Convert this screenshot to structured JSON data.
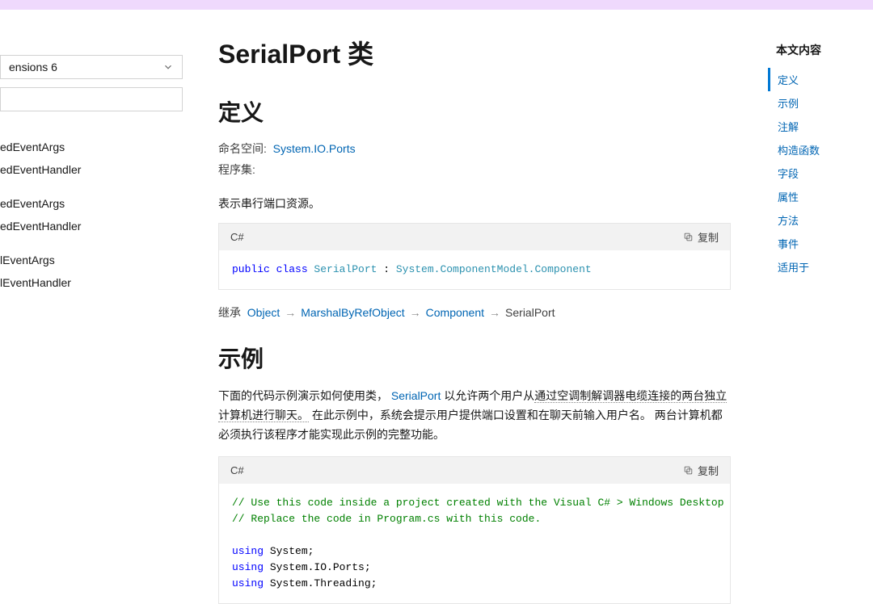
{
  "banner_text": "",
  "sidebar": {
    "version_label": "ensions 6",
    "groups": [
      {
        "items": [
          "edEventArgs",
          "edEventHandler"
        ]
      },
      {
        "items": [
          "edEventArgs",
          "edEventHandler"
        ]
      },
      {
        "items": [
          "lEventArgs",
          "lEventHandler"
        ]
      }
    ]
  },
  "page": {
    "title": "SerialPort 类",
    "h2_definition": "定义",
    "namespace_label": "命名空间:",
    "namespace_link": "System.IO.Ports",
    "assembly_label": "程序集:",
    "summary": "表示串行端口资源。",
    "code1": {
      "lang": "C#",
      "copy": "复制",
      "tokens": [
        {
          "t": "public class ",
          "c": "kw-blue"
        },
        {
          "t": "SerialPort",
          "c": "kw-teal"
        },
        {
          "t": " : ",
          "c": "kw-black"
        },
        {
          "t": "System.ComponentModel.Component",
          "c": "kw-teal"
        }
      ]
    },
    "inherit": {
      "label": "继承",
      "chain": [
        "Object",
        "MarshalByRefObject",
        "Component"
      ],
      "final": "SerialPort"
    },
    "h2_example": "示例",
    "example_p1_pre": "下面的代码示例演示如何使用类，",
    "example_p1_link": "SerialPort",
    "example_p1_mid": " 以允许两个用户从",
    "example_p1_dotted": "通过空调制解调器电缆连接的两台独立计算机进行聊天。",
    "example_p1_post": " 在此示例中，系统会提示用户提供端口设置和在聊天前输入用户名。 两台计算机都必须执行该程序才能实现此示例的完整功能。",
    "code2": {
      "lang": "C#",
      "copy": "复制",
      "lines": [
        {
          "t": "// Use this code inside a project created with the Visual C# > Windows Desktop > Console Application template.",
          "c": "kw-green"
        },
        {
          "t": "// Replace the code in Program.cs with this code.",
          "c": "kw-green"
        },
        {
          "t": "",
          "c": ""
        },
        {
          "pairs": [
            {
              "t": "using",
              "c": "kw-blue"
            },
            {
              "t": " System;",
              "c": "kw-black"
            }
          ]
        },
        {
          "pairs": [
            {
              "t": "using",
              "c": "kw-blue"
            },
            {
              "t": " System.IO.Ports;",
              "c": "kw-black"
            }
          ]
        },
        {
          "pairs": [
            {
              "t": "using",
              "c": "kw-blue"
            },
            {
              "t": " System.Threading;",
              "c": "kw-black"
            }
          ]
        }
      ]
    }
  },
  "toc": {
    "title": "本文内容",
    "items": [
      {
        "label": "定义",
        "active": true
      },
      {
        "label": "示例",
        "active": false
      },
      {
        "label": "注解",
        "active": false
      },
      {
        "label": "构造函数",
        "active": false
      },
      {
        "label": "字段",
        "active": false
      },
      {
        "label": "属性",
        "active": false
      },
      {
        "label": "方法",
        "active": false
      },
      {
        "label": "事件",
        "active": false
      },
      {
        "label": "适用于",
        "active": false
      }
    ]
  }
}
